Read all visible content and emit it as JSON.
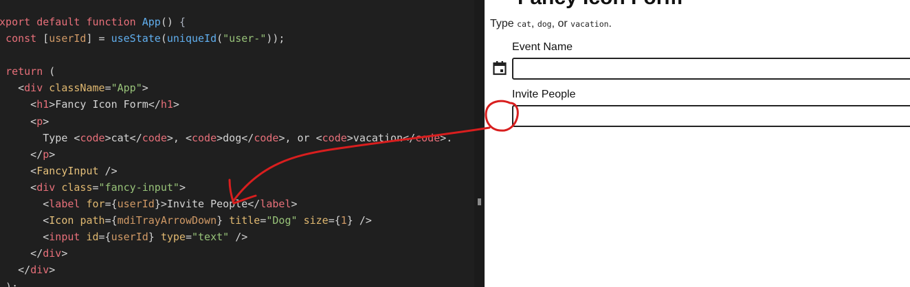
{
  "editor": {
    "lines": [
      [
        [
          "keyword",
          "export default "
        ],
        [
          "keyword",
          "function "
        ],
        [
          "func",
          "App"
        ],
        [
          "plain",
          "() "
        ],
        [
          "punct",
          "{"
        ]
      ],
      [
        [
          "plain",
          "  "
        ],
        [
          "keyword",
          "const "
        ],
        [
          "plain",
          "["
        ],
        [
          "var",
          "userId"
        ],
        [
          "plain",
          "] = "
        ],
        [
          "func",
          "useState"
        ],
        [
          "plain",
          "("
        ],
        [
          "func",
          "uniqueId"
        ],
        [
          "plain",
          "("
        ],
        [
          "string",
          "\"user-\""
        ],
        [
          "plain",
          "));"
        ]
      ],
      [],
      [
        [
          "plain",
          "  "
        ],
        [
          "keyword",
          "return "
        ],
        [
          "plain",
          "("
        ]
      ],
      [
        [
          "plain",
          "    <"
        ],
        [
          "tag",
          "div "
        ],
        [
          "attr",
          "className"
        ],
        [
          "plain",
          "="
        ],
        [
          "string",
          "\"App\""
        ],
        [
          "plain",
          ">"
        ]
      ],
      [
        [
          "plain",
          "      <"
        ],
        [
          "tag",
          "h1"
        ],
        [
          "plain",
          ">Fancy Icon Form</"
        ],
        [
          "tag",
          "h1"
        ],
        [
          "plain",
          ">"
        ]
      ],
      [
        [
          "plain",
          "      <"
        ],
        [
          "tag",
          "p"
        ],
        [
          "plain",
          ">"
        ]
      ],
      [
        [
          "plain",
          "        Type <"
        ],
        [
          "tag",
          "code"
        ],
        [
          "plain",
          ">cat</"
        ],
        [
          "tag",
          "code"
        ],
        [
          "plain",
          ">, <"
        ],
        [
          "tag",
          "code"
        ],
        [
          "plain",
          ">dog</"
        ],
        [
          "tag",
          "code"
        ],
        [
          "plain",
          ">, or <"
        ],
        [
          "tag",
          "code"
        ],
        [
          "plain",
          ">vacation</"
        ],
        [
          "tag",
          "code"
        ],
        [
          "plain",
          ">."
        ]
      ],
      [
        [
          "plain",
          "      </"
        ],
        [
          "tag",
          "p"
        ],
        [
          "plain",
          ">"
        ]
      ],
      [
        [
          "plain",
          "      <"
        ],
        [
          "comp",
          "FancyInput"
        ],
        [
          "plain",
          " />"
        ]
      ],
      [
        [
          "plain",
          "      <"
        ],
        [
          "tag",
          "div "
        ],
        [
          "attr",
          "class"
        ],
        [
          "plain",
          "="
        ],
        [
          "string",
          "\"fancy-input\""
        ],
        [
          "plain",
          ">"
        ]
      ],
      [
        [
          "plain",
          "        <"
        ],
        [
          "tag",
          "label "
        ],
        [
          "attr",
          "for"
        ],
        [
          "plain",
          "={"
        ],
        [
          "var",
          "userId"
        ],
        [
          "plain",
          "}>Invite People</"
        ],
        [
          "tag",
          "label"
        ],
        [
          "plain",
          ">"
        ]
      ],
      [
        [
          "plain",
          "        <"
        ],
        [
          "comp",
          "Icon "
        ],
        [
          "attr",
          "path"
        ],
        [
          "plain",
          "={"
        ],
        [
          "var",
          "mdiTrayArrowDown"
        ],
        [
          "plain",
          "} "
        ],
        [
          "attr",
          "title"
        ],
        [
          "plain",
          "="
        ],
        [
          "string",
          "\"Dog\""
        ],
        [
          "plain",
          " "
        ],
        [
          "attr",
          "size"
        ],
        [
          "plain",
          "={"
        ],
        [
          "var",
          "1"
        ],
        [
          "plain",
          "} />"
        ]
      ],
      [
        [
          "plain",
          "        <"
        ],
        [
          "tag",
          "input "
        ],
        [
          "attr",
          "id"
        ],
        [
          "plain",
          "={"
        ],
        [
          "var",
          "userId"
        ],
        [
          "plain",
          "} "
        ],
        [
          "attr",
          "type"
        ],
        [
          "plain",
          "="
        ],
        [
          "string",
          "\"text\""
        ],
        [
          "plain",
          " />"
        ]
      ],
      [
        [
          "plain",
          "      </"
        ],
        [
          "tag",
          "div"
        ],
        [
          "plain",
          ">"
        ]
      ],
      [
        [
          "plain",
          "    </"
        ],
        [
          "tag",
          "div"
        ],
        [
          "plain",
          ">"
        ]
      ],
      [
        [
          "plain",
          "  );"
        ]
      ]
    ]
  },
  "preview": {
    "title": "Fancy Icon Form",
    "intro": {
      "prefix": "Type ",
      "code1": "cat",
      "sep1": ", ",
      "code2": "dog",
      "sep2": ", or ",
      "code3": "vacation",
      "suffix": "."
    },
    "event_field": {
      "label": "Event Name",
      "value": "",
      "icon": "calendar-icon"
    },
    "invite_field": {
      "label": "Invite People",
      "value": ""
    }
  },
  "colors": {
    "editor_bg": "#1f1f1f",
    "annotation": "#d81e1e"
  }
}
